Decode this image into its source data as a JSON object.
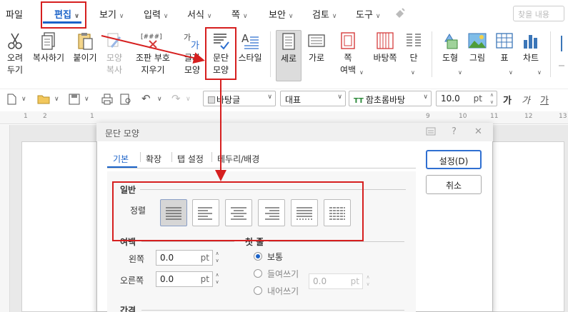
{
  "menu": {
    "items": [
      "파일",
      "편집",
      "보기",
      "입력",
      "서식",
      "쪽",
      "보안",
      "검토",
      "도구"
    ],
    "active": "편집",
    "search_placeholder": "찾을 내용"
  },
  "ribbon": {
    "cut": [
      "오려",
      "두기"
    ],
    "copy": "복사하기",
    "paste": "붙이기",
    "format_copy": [
      "모양",
      "복사"
    ],
    "code_remove": [
      "조판 부호",
      "지우기"
    ],
    "char_shape": [
      "글자",
      "모양"
    ],
    "para_shape": [
      "문단",
      "모양"
    ],
    "style": "스타일",
    "portrait": "세로",
    "landscape": "가로",
    "margin": [
      "쪽",
      "여백"
    ],
    "page_border": "바탕쪽",
    "column": "단",
    "shapes": "도형",
    "picture": "그림",
    "table": "표",
    "chart": "차트",
    "code_icon_text": "[###]"
  },
  "toolbar": {
    "style_combo": "바탕글",
    "lang_combo": "대표",
    "font_combo": "함초롬바탕",
    "size_value": "10.0",
    "size_unit": "pt",
    "text_style_a": "가",
    "text_style_b": "가",
    "text_style_c": "가"
  },
  "ruler": {
    "numbers": [
      "1",
      "2",
      "1",
      "2",
      "3",
      "4",
      "5",
      "6",
      "7",
      "8",
      "9",
      "10",
      "11",
      "12",
      "13"
    ]
  },
  "dialog": {
    "title": "문단 모양",
    "tabs": [
      "기본",
      "확장",
      "탭 설정",
      "테두리/배경"
    ],
    "ok_button": "설정(D)",
    "cancel_button": "취소",
    "general_label": "일반",
    "align_label": "정렬",
    "margin_label": "여백",
    "left_label": "왼쪽",
    "left_value": "0.0",
    "right_label": "오른쪽",
    "right_value": "0.0",
    "unit": "pt",
    "first_line_label": "첫 줄",
    "first_line_options": [
      "보통",
      "들여쓰기",
      "내어쓰기"
    ],
    "first_line_selected": "보통",
    "first_line_value": "0.0",
    "spacing_label": "간격"
  },
  "colors": {
    "accent": "#1a62c8",
    "annotation": "#d61f1f"
  }
}
